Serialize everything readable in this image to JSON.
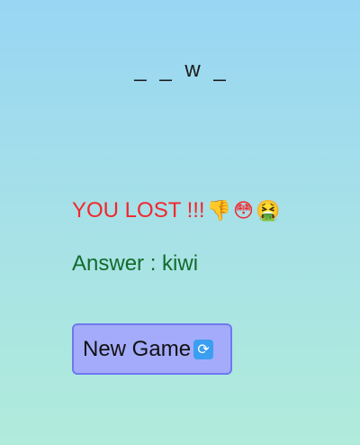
{
  "word": {
    "slots": [
      "_",
      "_",
      "w",
      "_"
    ]
  },
  "status": {
    "text": "YOU LOST !!!",
    "color": "#f3262c",
    "emojis": [
      "👎",
      "😳",
      "🤮"
    ],
    "emoji_icons": [
      "thumbs-down-icon",
      "flushed-face-icon",
      "vomiting-face-icon"
    ]
  },
  "answer": {
    "text": "Answer : kiwi",
    "color": "#126b2c"
  },
  "new_game_button": {
    "label": "New Game",
    "icon": "🔄",
    "icon_name": "refresh-icon",
    "background": "#a4abfb",
    "border": "#6f78f0"
  },
  "background": {
    "gradient_top": "#98d6f3",
    "gradient_bottom": "#b0ebdb"
  }
}
